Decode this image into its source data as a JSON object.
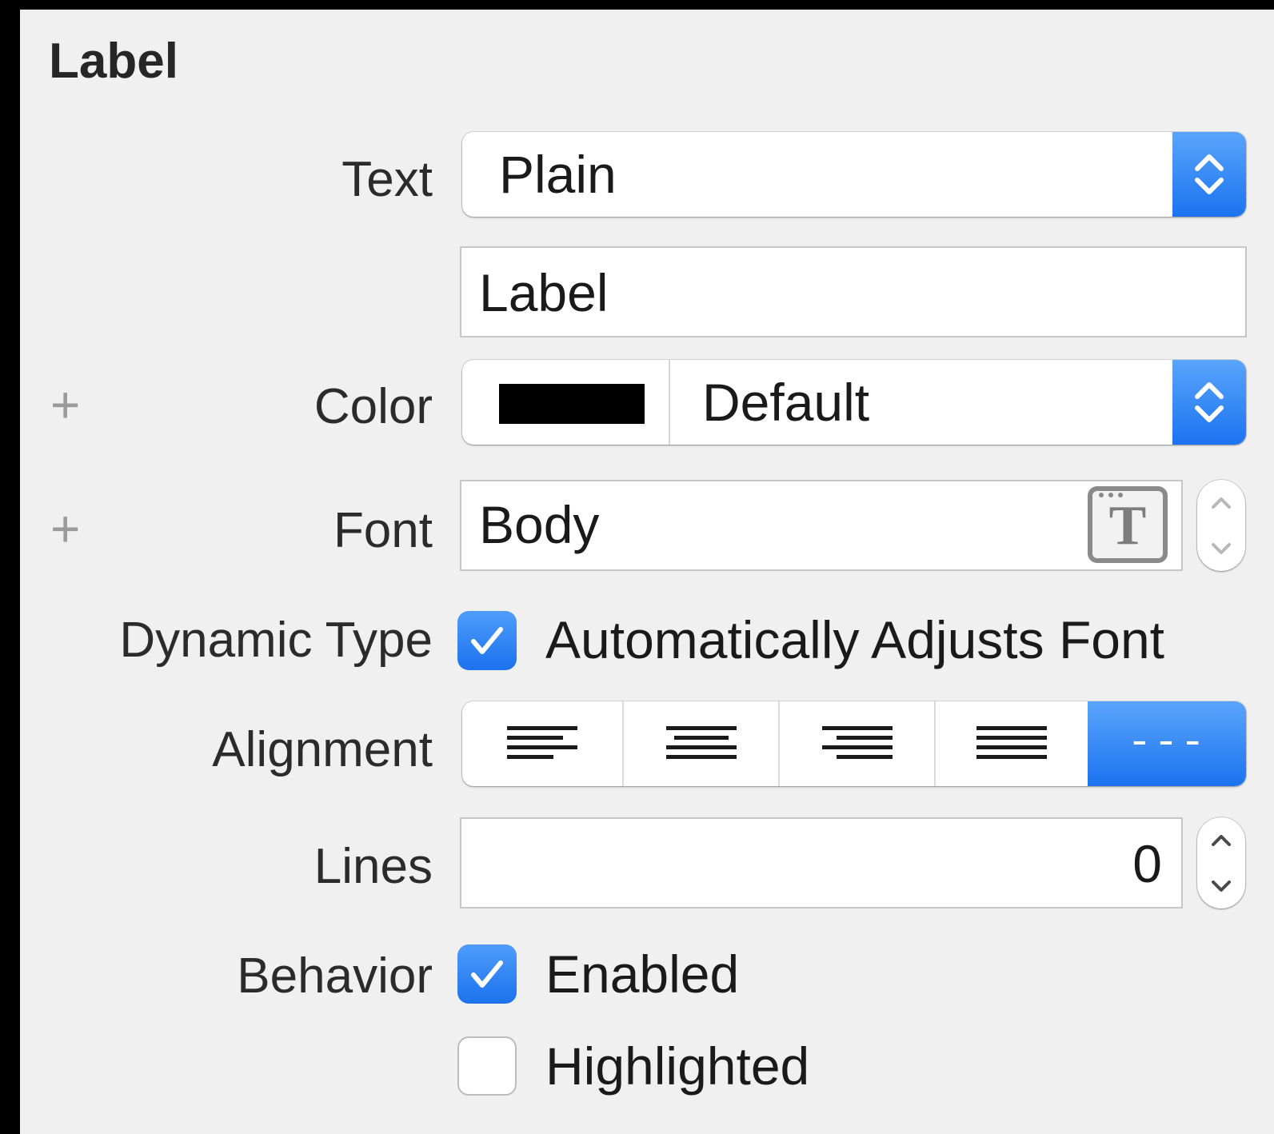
{
  "section": {
    "title": "Label"
  },
  "text_row": {
    "label": "Text",
    "type_value": "Plain",
    "content_value": "Label"
  },
  "color_row": {
    "label": "Color",
    "swatch_color": "#000000",
    "value": "Default"
  },
  "font_row": {
    "label": "Font",
    "value": "Body",
    "font_picker_icon": "T"
  },
  "dynamic_type_row": {
    "label": "Dynamic Type",
    "checkbox_label": "Automatically Adjusts Font",
    "checked": true
  },
  "alignment_row": {
    "label": "Alignment",
    "options": [
      "left",
      "center",
      "right",
      "justified",
      "natural"
    ],
    "selected": "natural",
    "natural_label": "---"
  },
  "lines_row": {
    "label": "Lines",
    "value": "0"
  },
  "behavior_row": {
    "label": "Behavior",
    "enabled_label": "Enabled",
    "enabled_checked": true,
    "highlighted_label": "Highlighted",
    "highlighted_checked": false
  },
  "colors": {
    "accent": "#1b73f0",
    "panel_background": "#f0f0f0"
  }
}
